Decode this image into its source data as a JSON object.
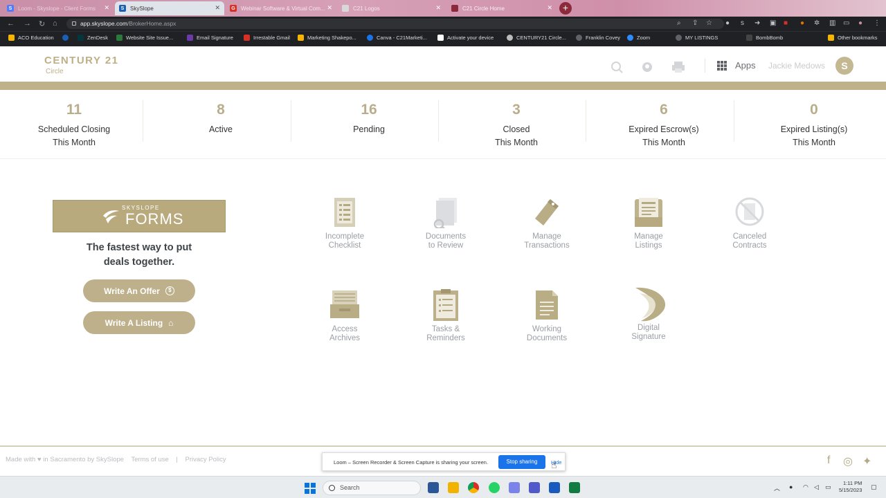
{
  "browser": {
    "tabs": [
      {
        "title": "Loom - Skyslope - Client Forms",
        "color": "#4f7cff",
        "icon_text": "S"
      },
      {
        "title": "SkySlope",
        "color": "#1a5fb4",
        "icon_text": "S"
      },
      {
        "title": "Webinar Software & Virtual Com...",
        "color": "#d93025",
        "icon_text": "G"
      },
      {
        "title": "C21 Logos",
        "color": "#d8d8d8",
        "icon_text": ""
      },
      {
        "title": "C21 Circle Home",
        "color": "#8c2a3c",
        "icon_text": ""
      }
    ],
    "new_tab_icon": "+",
    "url_domain": "app.skyslope.com",
    "url_path": "/BrokerHome.aspx",
    "bookmarks": [
      {
        "label": "ACO Education",
        "color": "#f4b400"
      },
      {
        "label": "",
        "color": "#1a5fb4"
      },
      {
        "label": "ZenDesk",
        "color": "#03363d"
      },
      {
        "label": "Website Site Issue...",
        "color": "#2b7a3a"
      },
      {
        "label": "Email Signature",
        "color": "#6a3aa8"
      },
      {
        "label": "Irrestable Gmail",
        "color": "#d93025"
      },
      {
        "label": "Marketing Shakepo...",
        "color": "#f4b400"
      },
      {
        "label": "Canva - C21Marketi...",
        "color": "#1a73e8"
      },
      {
        "label": "Activate your device",
        "color": "#111111"
      },
      {
        "label": "CENTURY21 Circle...",
        "color": "#bbbbbb"
      },
      {
        "label": "Franklin Covey",
        "color": "#5f6368"
      },
      {
        "label": "Zoom",
        "color": "#2d8cff"
      },
      {
        "label": "MY LISTINGS",
        "color": "#5f6368"
      },
      {
        "label": "BombBomb",
        "color": "#202124"
      },
      {
        "label": "Other bookmarks",
        "color": "#f4b400"
      }
    ]
  },
  "header": {
    "logo_brand": "CENTURY 21",
    "logo_sub": "Circle",
    "apps_label": "Apps",
    "user_name": "Jackie Medows",
    "avatar_letter": "S",
    "accent": "#bfb18a"
  },
  "stats": [
    {
      "value": "11",
      "label_1": "Scheduled Closing",
      "label_2": "This Month"
    },
    {
      "value": "8",
      "label_1": "Active",
      "label_2": ""
    },
    {
      "value": "16",
      "label_1": "Pending",
      "label_2": ""
    },
    {
      "value": "3",
      "label_1": "Closed",
      "label_2": "This Month"
    },
    {
      "value": "6",
      "label_1": "Expired Escrow(s)",
      "label_2": "This Month"
    },
    {
      "value": "0",
      "label_1": "Expired Listing(s)",
      "label_2": "This Month"
    }
  ],
  "forms": {
    "banner_small": "SKYSLOPE",
    "banner_big": "FORMS",
    "tagline_1": "The fastest way to put",
    "tagline_2": "deals together.",
    "write_offer": "Write An Offer",
    "write_listing": "Write A Listing"
  },
  "tiles": [
    {
      "label_1": "Incomplete",
      "label_2": "Checklist",
      "icon": "checklist-icon"
    },
    {
      "label_1": "Documents",
      "label_2": "to Review",
      "icon": "documents-review-icon"
    },
    {
      "label_1": "Manage",
      "label_2": "Transactions",
      "icon": "transactions-icon"
    },
    {
      "label_1": "Manage",
      "label_2": "Listings",
      "icon": "listings-icon"
    },
    {
      "label_1": "Canceled",
      "label_2": "Contracts",
      "icon": "canceled-contracts-icon"
    },
    {
      "label_1": "Access",
      "label_2": "Archives",
      "icon": "archive-box-icon"
    },
    {
      "label_1": "Tasks &",
      "label_2": "Reminders",
      "icon": "tasks-icon"
    },
    {
      "label_1": "Working",
      "label_2": "Documents",
      "icon": "working-documents-icon"
    },
    {
      "label_1": "Digital",
      "label_2": "Signature",
      "icon": "digital-signature-icon"
    }
  ],
  "footer": {
    "made_with": "Made with ♥ in Sacramento by SkySlope",
    "terms": "Terms of use",
    "sep": "|",
    "privacy": "Privacy Policy"
  },
  "loom": {
    "message": "Loom – Screen Recorder & Screen Capture is sharing your screen.",
    "stop": "Stop sharing",
    "hide": "Hide"
  },
  "taskbar": {
    "search": "Search",
    "time": "1:11 PM",
    "date": "5/15/2023"
  }
}
